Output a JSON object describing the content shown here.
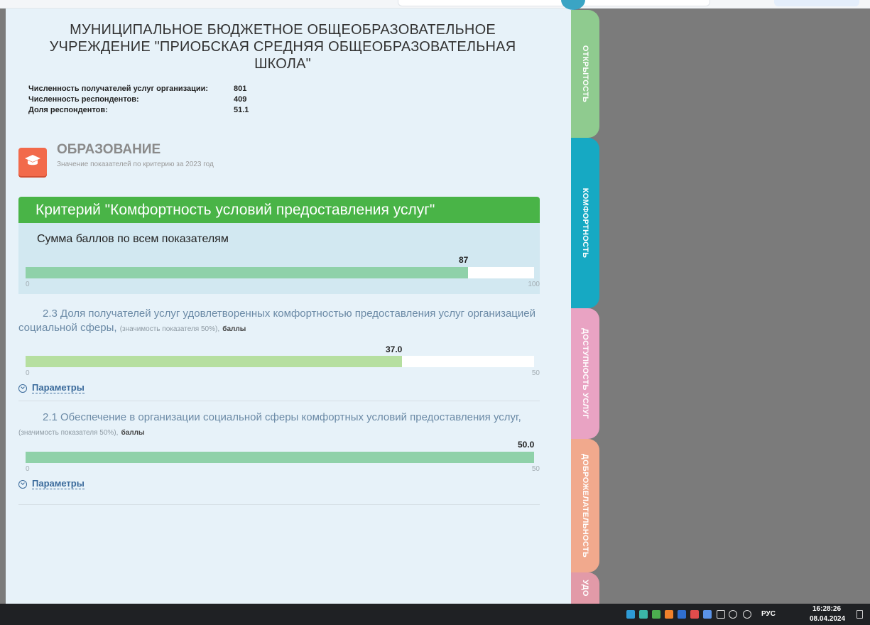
{
  "org": {
    "title_lines": [
      "МУНИЦИПАЛЬНОЕ БЮДЖЕТНОЕ ОБЩЕОБРАЗОВАТЕЛЬНОЕ",
      "УЧРЕЖДЕНИЕ \"ПРИОБСКАЯ СРЕДНЯЯ ОБЩЕОБРАЗОВАТЕЛЬНАЯ",
      "ШКОЛА\""
    ],
    "stats": [
      {
        "label": "Численность получателей услуг организации:",
        "value": "801"
      },
      {
        "label": "Численность респондентов:",
        "value": "409"
      },
      {
        "label": "Доля респондентов:",
        "value": "51.1"
      }
    ]
  },
  "category": {
    "icon": "graduation-cap-icon",
    "title": "ОБРАЗОВАНИЕ",
    "subtitle": "Значение показателей по критерию за 2023 год"
  },
  "criterion": {
    "title": "Критерий \"Комфортность условий предоставления услуг\"",
    "sum": {
      "label": "Сумма баллов по всем показателям",
      "value": 87,
      "value_label": "87",
      "min": "0",
      "max": "100",
      "max_value": 100
    }
  },
  "indicators": [
    {
      "title": "2.3 Доля получателей услуг удовлетворенных комфортностью предоставления услуг организацией социальной сферы,",
      "weight": "(значимость показателя 50%),",
      "unit": "баллы",
      "value": 37.0,
      "value_label": "37.0",
      "min": "0",
      "max": "50",
      "max_value": 50,
      "params_label": "Параметры"
    },
    {
      "title": "2.1 Обеспечение в организации социальной сферы комфортных условий предоставления услуг,",
      "weight": "(значимость показателя 50%),",
      "unit": "баллы",
      "value": 50.0,
      "value_label": "50.0",
      "min": "0",
      "max": "50",
      "max_value": 50,
      "params_label": "Параметры"
    }
  ],
  "side_tabs": [
    {
      "label": "ОТКРЫТОСТЬ",
      "color": "#8fcb8f"
    },
    {
      "label": "КОМФОРТНОСТЬ",
      "color": "#16a9c3"
    },
    {
      "label": "ДОСТУПНОСТЬ УСЛУГ",
      "color": "#e9a3c3"
    },
    {
      "label": "ДОБРОЖЕЛАТЕЛЬНОСТЬ",
      "color": "#f1a98d"
    },
    {
      "label": "УДО",
      "color": "#e29aa8"
    }
  ],
  "taskbar": {
    "lang": "РУС",
    "time": "16:28:26",
    "date": "08.04.2024"
  },
  "colors": {
    "header_green": "#49b447",
    "sum_bar": "#8fd1a9",
    "ind_bar_1": "#b6dfa0",
    "ind_bar_2": "#8fd1a9"
  }
}
